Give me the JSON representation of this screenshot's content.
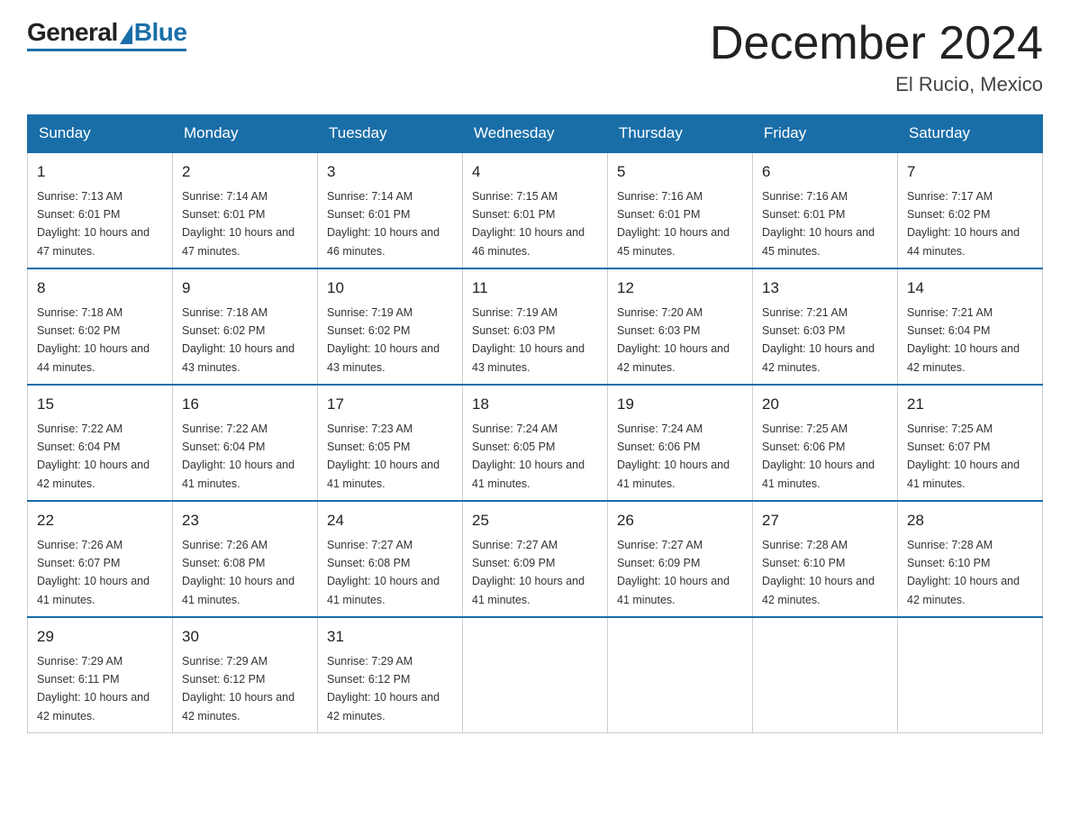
{
  "header": {
    "logo_general": "General",
    "logo_blue": "Blue",
    "month_title": "December 2024",
    "location": "El Rucio, Mexico"
  },
  "calendar": {
    "days_of_week": [
      "Sunday",
      "Monday",
      "Tuesday",
      "Wednesday",
      "Thursday",
      "Friday",
      "Saturday"
    ],
    "weeks": [
      [
        {
          "day": "1",
          "sunrise": "7:13 AM",
          "sunset": "6:01 PM",
          "daylight": "10 hours and 47 minutes."
        },
        {
          "day": "2",
          "sunrise": "7:14 AM",
          "sunset": "6:01 PM",
          "daylight": "10 hours and 47 minutes."
        },
        {
          "day": "3",
          "sunrise": "7:14 AM",
          "sunset": "6:01 PM",
          "daylight": "10 hours and 46 minutes."
        },
        {
          "day": "4",
          "sunrise": "7:15 AM",
          "sunset": "6:01 PM",
          "daylight": "10 hours and 46 minutes."
        },
        {
          "day": "5",
          "sunrise": "7:16 AM",
          "sunset": "6:01 PM",
          "daylight": "10 hours and 45 minutes."
        },
        {
          "day": "6",
          "sunrise": "7:16 AM",
          "sunset": "6:01 PM",
          "daylight": "10 hours and 45 minutes."
        },
        {
          "day": "7",
          "sunrise": "7:17 AM",
          "sunset": "6:02 PM",
          "daylight": "10 hours and 44 minutes."
        }
      ],
      [
        {
          "day": "8",
          "sunrise": "7:18 AM",
          "sunset": "6:02 PM",
          "daylight": "10 hours and 44 minutes."
        },
        {
          "day": "9",
          "sunrise": "7:18 AM",
          "sunset": "6:02 PM",
          "daylight": "10 hours and 43 minutes."
        },
        {
          "day": "10",
          "sunrise": "7:19 AM",
          "sunset": "6:02 PM",
          "daylight": "10 hours and 43 minutes."
        },
        {
          "day": "11",
          "sunrise": "7:19 AM",
          "sunset": "6:03 PM",
          "daylight": "10 hours and 43 minutes."
        },
        {
          "day": "12",
          "sunrise": "7:20 AM",
          "sunset": "6:03 PM",
          "daylight": "10 hours and 42 minutes."
        },
        {
          "day": "13",
          "sunrise": "7:21 AM",
          "sunset": "6:03 PM",
          "daylight": "10 hours and 42 minutes."
        },
        {
          "day": "14",
          "sunrise": "7:21 AM",
          "sunset": "6:04 PM",
          "daylight": "10 hours and 42 minutes."
        }
      ],
      [
        {
          "day": "15",
          "sunrise": "7:22 AM",
          "sunset": "6:04 PM",
          "daylight": "10 hours and 42 minutes."
        },
        {
          "day": "16",
          "sunrise": "7:22 AM",
          "sunset": "6:04 PM",
          "daylight": "10 hours and 41 minutes."
        },
        {
          "day": "17",
          "sunrise": "7:23 AM",
          "sunset": "6:05 PM",
          "daylight": "10 hours and 41 minutes."
        },
        {
          "day": "18",
          "sunrise": "7:24 AM",
          "sunset": "6:05 PM",
          "daylight": "10 hours and 41 minutes."
        },
        {
          "day": "19",
          "sunrise": "7:24 AM",
          "sunset": "6:06 PM",
          "daylight": "10 hours and 41 minutes."
        },
        {
          "day": "20",
          "sunrise": "7:25 AM",
          "sunset": "6:06 PM",
          "daylight": "10 hours and 41 minutes."
        },
        {
          "day": "21",
          "sunrise": "7:25 AM",
          "sunset": "6:07 PM",
          "daylight": "10 hours and 41 minutes."
        }
      ],
      [
        {
          "day": "22",
          "sunrise": "7:26 AM",
          "sunset": "6:07 PM",
          "daylight": "10 hours and 41 minutes."
        },
        {
          "day": "23",
          "sunrise": "7:26 AM",
          "sunset": "6:08 PM",
          "daylight": "10 hours and 41 minutes."
        },
        {
          "day": "24",
          "sunrise": "7:27 AM",
          "sunset": "6:08 PM",
          "daylight": "10 hours and 41 minutes."
        },
        {
          "day": "25",
          "sunrise": "7:27 AM",
          "sunset": "6:09 PM",
          "daylight": "10 hours and 41 minutes."
        },
        {
          "day": "26",
          "sunrise": "7:27 AM",
          "sunset": "6:09 PM",
          "daylight": "10 hours and 41 minutes."
        },
        {
          "day": "27",
          "sunrise": "7:28 AM",
          "sunset": "6:10 PM",
          "daylight": "10 hours and 42 minutes."
        },
        {
          "day": "28",
          "sunrise": "7:28 AM",
          "sunset": "6:10 PM",
          "daylight": "10 hours and 42 minutes."
        }
      ],
      [
        {
          "day": "29",
          "sunrise": "7:29 AM",
          "sunset": "6:11 PM",
          "daylight": "10 hours and 42 minutes."
        },
        {
          "day": "30",
          "sunrise": "7:29 AM",
          "sunset": "6:12 PM",
          "daylight": "10 hours and 42 minutes."
        },
        {
          "day": "31",
          "sunrise": "7:29 AM",
          "sunset": "6:12 PM",
          "daylight": "10 hours and 42 minutes."
        },
        null,
        null,
        null,
        null
      ]
    ]
  }
}
